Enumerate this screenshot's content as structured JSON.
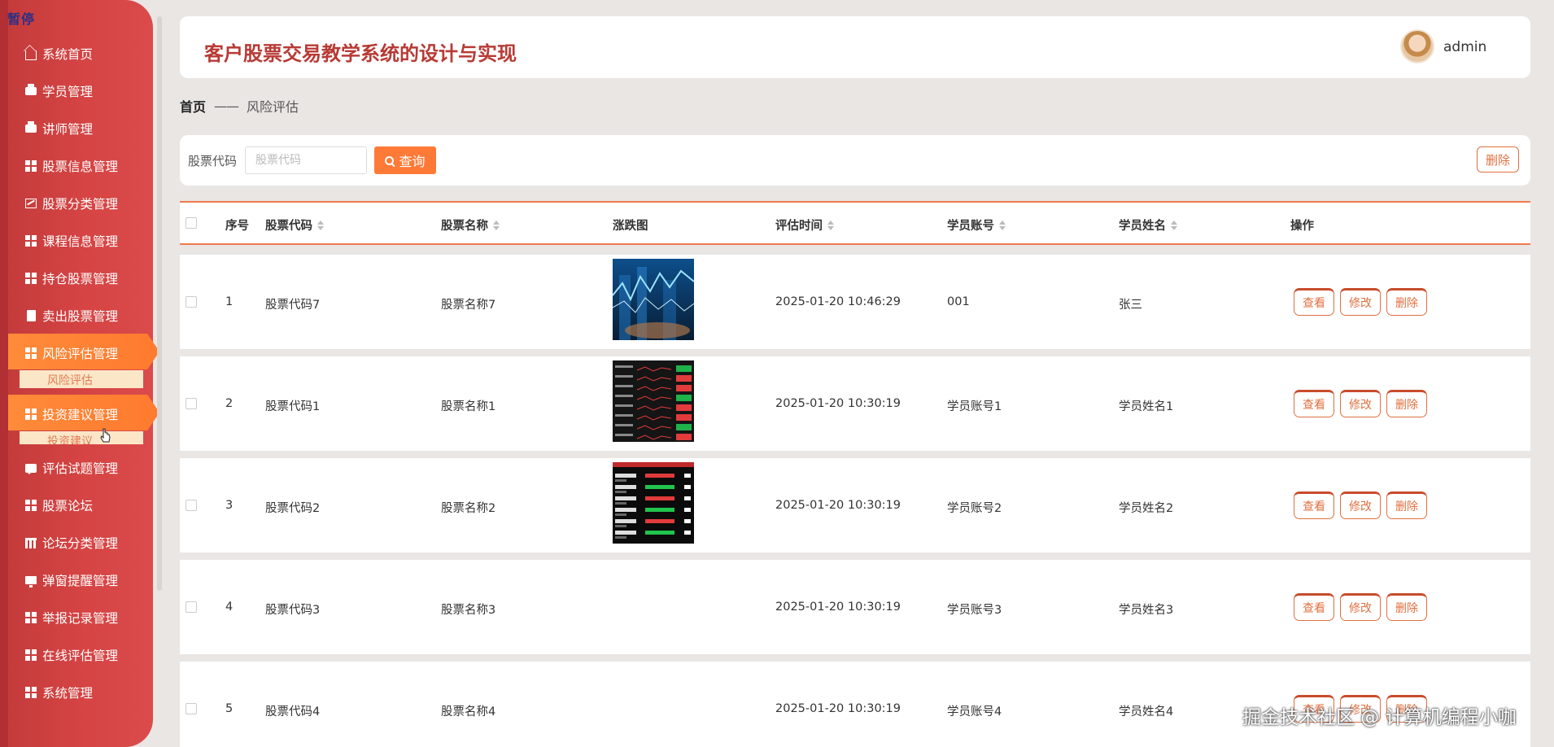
{
  "paused_label": "暂停",
  "sidebar": {
    "items": [
      {
        "label": "系统首页",
        "icon": "home-icon"
      },
      {
        "label": "学员管理",
        "icon": "print-icon"
      },
      {
        "label": "讲师管理",
        "icon": "print-icon"
      },
      {
        "label": "股票信息管理",
        "icon": "grid-icon"
      },
      {
        "label": "股票分类管理",
        "icon": "chart-icon"
      },
      {
        "label": "课程信息管理",
        "icon": "grid-icon"
      },
      {
        "label": "持仓股票管理",
        "icon": "grid-icon"
      },
      {
        "label": "卖出股票管理",
        "icon": "clipboard-icon"
      },
      {
        "label": "风险评估管理",
        "icon": "grid-icon",
        "active": true
      },
      {
        "label": "投资建议管理",
        "icon": "grid-icon",
        "active": true
      },
      {
        "label": "评估试题管理",
        "icon": "chat-icon"
      },
      {
        "label": "股票论坛",
        "icon": "grid-icon"
      },
      {
        "label": "论坛分类管理",
        "icon": "table-icon"
      },
      {
        "label": "弹窗提醒管理",
        "icon": "monitor-icon"
      },
      {
        "label": "举报记录管理",
        "icon": "grid-icon"
      },
      {
        "label": "在线评估管理",
        "icon": "grid-icon"
      },
      {
        "label": "系统管理",
        "icon": "grid-icon"
      }
    ],
    "sub_risk": "风险评估",
    "sub_advice": "投资建议"
  },
  "header": {
    "title": "客户股票交易教学系统的设计与实现",
    "user": "admin"
  },
  "breadcrumb": {
    "home": "首页",
    "separator": "——",
    "current": "风险评估"
  },
  "search": {
    "label": "股票代码",
    "placeholder": "股票代码",
    "button": "查询",
    "delete_button": "删除"
  },
  "table": {
    "columns": [
      "序号",
      "股票代码",
      "股票名称",
      "涨跌图",
      "评估时间",
      "学员账号",
      "学员姓名",
      "操作"
    ],
    "rows": [
      {
        "no": "1",
        "code": "股票代码7",
        "name": "股票名称7",
        "time": "2025-01-20 10:46:29",
        "account": "001",
        "student": "张三",
        "image": "stock-photo-blue"
      },
      {
        "no": "2",
        "code": "股票代码1",
        "name": "股票名称1",
        "time": "2025-01-20 10:30:19",
        "account": "学员账号1",
        "student": "学员姓名1",
        "image": "stock-list-screen"
      },
      {
        "no": "3",
        "code": "股票代码2",
        "name": "股票名称2",
        "time": "2025-01-20 10:30:19",
        "account": "学员账号2",
        "student": "学员姓名2",
        "image": "stock-quote-screen"
      },
      {
        "no": "4",
        "code": "股票代码3",
        "name": "股票名称3",
        "time": "2025-01-20 10:30:19",
        "account": "学员账号3",
        "student": "学员姓名3",
        "image": ""
      },
      {
        "no": "5",
        "code": "股票代码4",
        "name": "股票名称4",
        "time": "2025-01-20 10:30:19",
        "account": "学员账号4",
        "student": "学员姓名4",
        "image": ""
      }
    ],
    "actions": {
      "view": "查看",
      "edit": "修改",
      "delete": "删除"
    }
  },
  "watermark": "掘金技术社区 @ 计算机编程小咖",
  "colors": {
    "sidebar": "#d64444",
    "accent": "#ff7a36",
    "title": "#b83a35",
    "active_menu": "#ff8b3a"
  }
}
